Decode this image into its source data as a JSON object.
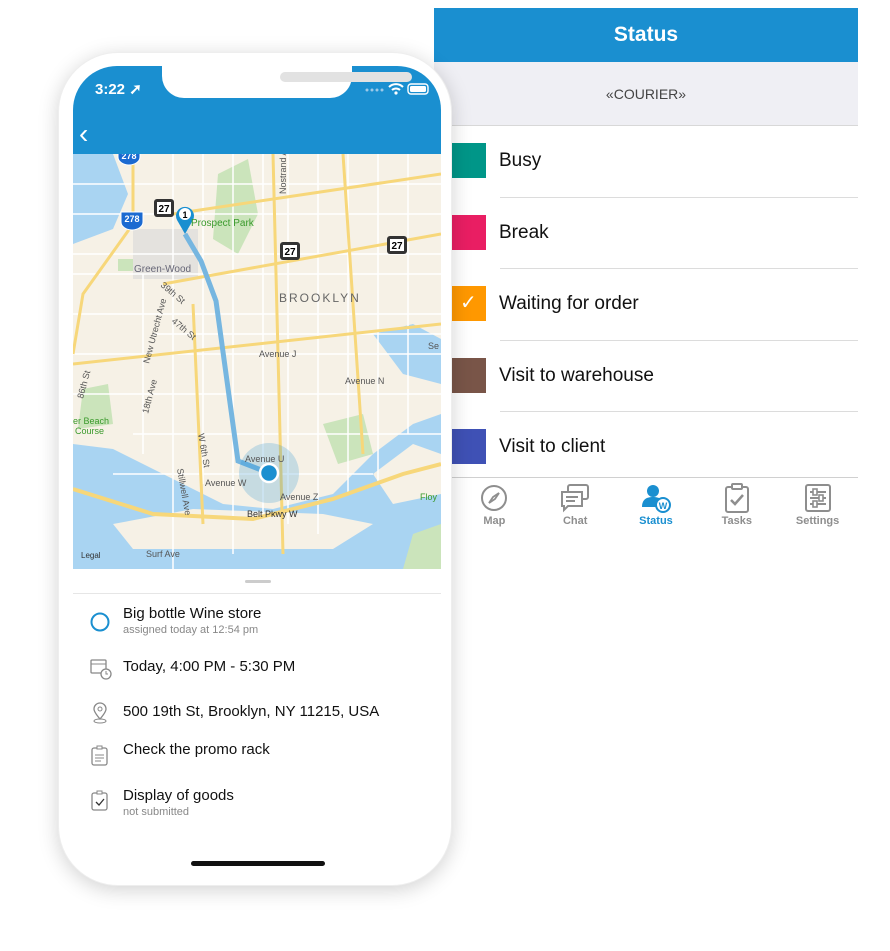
{
  "status_panel": {
    "title": "Status",
    "role": "«COURIER»",
    "items": [
      {
        "label": "Busy",
        "color": "#009688",
        "selected": false
      },
      {
        "label": "Break",
        "color": "#e91e63",
        "selected": false
      },
      {
        "label": "Waiting for order",
        "color": "#ff9800",
        "selected": true
      },
      {
        "label": "Visit to warehouse",
        "color": "#795548",
        "selected": false
      },
      {
        "label": "Visit to client",
        "color": "#3f51b5",
        "selected": false
      }
    ],
    "check_glyph": "✓",
    "tabs": [
      {
        "label": "Map",
        "icon": "compass-icon"
      },
      {
        "label": "Chat",
        "icon": "chat-icon"
      },
      {
        "label": "Status",
        "icon": "user-status-icon",
        "active": true
      },
      {
        "label": "Tasks",
        "icon": "clipboard-check-icon"
      },
      {
        "label": "Settings",
        "icon": "sliders-icon"
      }
    ],
    "accent": "#1a8fd0"
  },
  "phone": {
    "time": "3:22",
    "back_glyph": "‹",
    "map": {
      "labels": {
        "brooklyn": "BROOKLYN",
        "prospect_park": "Prospect Park",
        "green_wood": "Green-Wood",
        "nostrand": "Nostrand A",
        "st39": "39th St",
        "st47": "47th St",
        "new_utrecht": "New Utrecht Ave",
        "ave18": "18th Ave",
        "avenue_j": "Avenue J",
        "avenue_n": "Avenue N",
        "avenue_u": "Avenue U",
        "avenue_w": "Avenue W",
        "avenue_z": "Avenue Z",
        "belt": "Belt Pkwy W",
        "surf": "Surf Ave",
        "w6th": "W 6th St",
        "stillwell": "Stillwell Ave",
        "st86": "86th St",
        "beach": "er Beach",
        "course": "Course",
        "floy": "Floy",
        "legal": "Legal",
        "se": "Se"
      },
      "shields": {
        "i278": "278",
        "r27": "27"
      },
      "pin_number": "1"
    },
    "task": {
      "title": "Big bottle Wine store",
      "assigned": "assigned today at 12:54 pm",
      "time_window": "Today, 4:00 PM - 5:30 PM",
      "address": "500 19th St, Brooklyn, NY 11215, USA",
      "note": "Check the promo rack",
      "form_title": "Display of goods",
      "form_status": "not submitted"
    }
  }
}
